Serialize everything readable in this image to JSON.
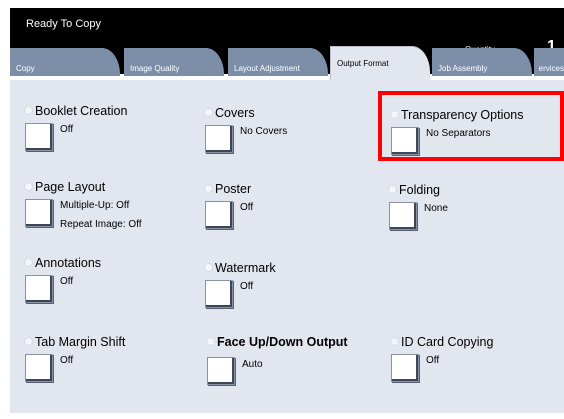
{
  "header": {
    "status": "Ready To Copy",
    "quantity_label": "Quantity",
    "quantity_value": "1"
  },
  "tabs": [
    {
      "label": "Copy",
      "active": false
    },
    {
      "label": "Image Quality",
      "active": false
    },
    {
      "label": "Layout Adjustment",
      "active": false
    },
    {
      "label": "Output Format",
      "active": true
    },
    {
      "label": "Job Assembly",
      "active": false
    },
    {
      "label": "ervices",
      "active": false
    }
  ],
  "features": {
    "booklet": {
      "title": "Booklet Creation",
      "value": "Off"
    },
    "covers": {
      "title": "Covers",
      "value": "No Covers"
    },
    "transparency": {
      "title": "Transparency Options",
      "value": "No Separators"
    },
    "page_layout": {
      "title": "Page Layout",
      "value": "Multiple-Up: Off",
      "value2": "Repeat Image: Off"
    },
    "poster": {
      "title": "Poster",
      "value": "Off"
    },
    "folding": {
      "title": "Folding",
      "value": "None"
    },
    "annotations": {
      "title": "Annotations",
      "value": "Off"
    },
    "watermark": {
      "title": "Watermark",
      "value": "Off"
    },
    "tab_margin": {
      "title": "Tab Margin Shift",
      "value": "Off"
    },
    "face_up_down": {
      "title": "Face Up/Down Output",
      "value": "Auto"
    },
    "id_card": {
      "title": "ID Card Copying",
      "value": "Off"
    }
  },
  "colors": {
    "highlight": "#ff0000",
    "tab_inactive": "#7d8ea9",
    "panel_bg": "#e1e6ef"
  }
}
